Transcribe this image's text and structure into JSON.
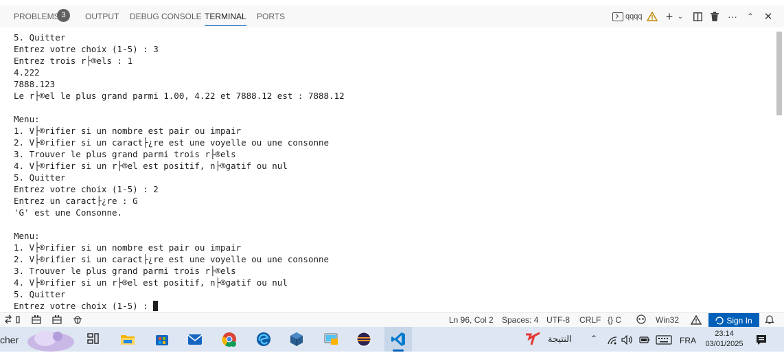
{
  "panel": {
    "tabs": [
      {
        "label": "PROBLEMS"
      },
      {
        "label": "OUTPUT"
      },
      {
        "label": "DEBUG CONSOLE"
      },
      {
        "label": "TERMINAL"
      },
      {
        "label": "PORTS"
      }
    ],
    "problems_count": "3",
    "terminal_name": "qqqq"
  },
  "terminal": {
    "lines": [
      "5. Quitter",
      "Entrez votre choix (1-5) : 3",
      "Entrez trois r├®els : 1",
      "4.222",
      "7888.123",
      "Le r├®el le plus grand parmi 1.00, 4.22 et 7888.12 est : 7888.12",
      "",
      "Menu:",
      "1. V├®rifier si un nombre est pair ou impair",
      "2. V├®rifier si un caract├¿re est une voyelle ou une consonne",
      "3. Trouver le plus grand parmi trois r├®els",
      "4. V├®rifier si un r├®el est positif, n├®gatif ou nul",
      "5. Quitter",
      "Entrez votre choix (1-5) : 2",
      "Entrez un caract├¿re : G",
      "'G' est une Consonne.",
      "",
      "Menu:",
      "1. V├®rifier si un nombre est pair ou impair",
      "2. V├®rifier si un caract├¿re est une voyelle ou une consonne",
      "3. Trouver le plus grand parmi trois r├®els",
      "4. V├®rifier si un r├®el est positif, n├®gatif ou nul",
      "5. Quitter",
      "Entrez votre choix (1-5) : "
    ]
  },
  "statusbar": {
    "position": "Ln 96, Col 2",
    "spaces": "Spaces: 4",
    "encoding": "UTF-8",
    "eol": "CRLF",
    "language": "{} C",
    "platform": "Win32",
    "sign_in": "Sign In"
  },
  "taskbar": {
    "search_fragment": "cher",
    "arabic_label": "النتيجة",
    "language": "FRA",
    "time": "23:14",
    "date": "03/01/2025"
  },
  "colors": {
    "accent": "#005fb8",
    "warning": "#bf8803",
    "edge_blue": "#0c59a4",
    "vscode_blue": "#007acc"
  }
}
